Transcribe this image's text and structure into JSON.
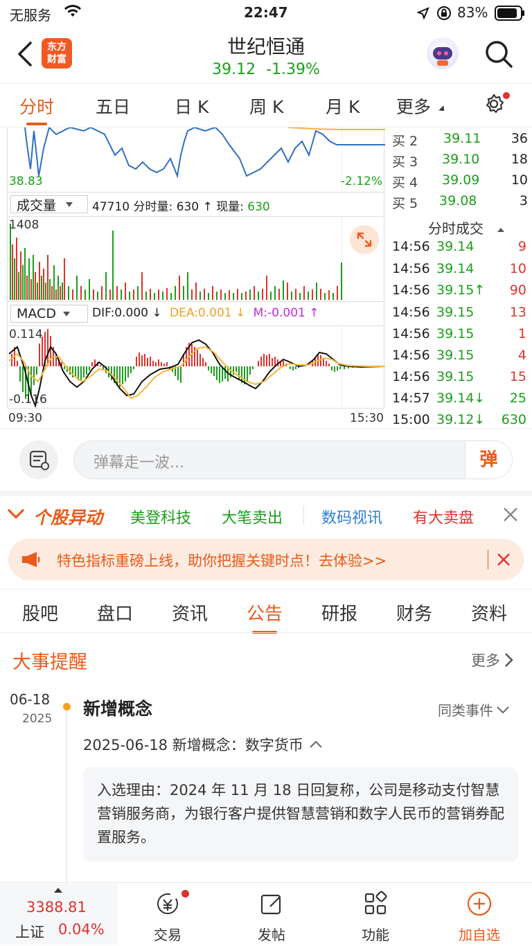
{
  "status_bar": {
    "carrier": "无服务",
    "time": "22:47",
    "battery": "83%"
  },
  "header": {
    "app_logo_text": "东方\n财富",
    "stock_name": "世纪恒通",
    "price": "39.12",
    "change_pct": "-1.39%"
  },
  "tabs": [
    {
      "label": "分时",
      "active": true
    },
    {
      "label": "五日"
    },
    {
      "label": "日 K"
    },
    {
      "label": "周 K"
    },
    {
      "label": "月 K"
    },
    {
      "label": "更多"
    }
  ],
  "price_chart": {
    "low_label": "38.83",
    "low_pct": "-2.12%"
  },
  "volume": {
    "selector": "成交量",
    "info_total": "47710",
    "info_min_label": "分时量:",
    "info_min_value": "630",
    "info_now_label": "现量:",
    "info_now_value": "630",
    "max_label": "1408"
  },
  "macd": {
    "selector": "MACD",
    "dif": "DIF:0.000 ↓",
    "dea": "DEA:0.001 ↓",
    "m": "M:-0.001 ↑",
    "top_label": "0.114",
    "bottom_label": "-0.116",
    "start_time": "09:30",
    "end_time": "15:30"
  },
  "order_book": [
    {
      "label": "买 2",
      "price": "39.11",
      "vol": "36"
    },
    {
      "label": "买 3",
      "price": "39.10",
      "vol": "18"
    },
    {
      "label": "买 4",
      "price": "39.09",
      "vol": "10"
    },
    {
      "label": "买 5",
      "price": "39.08",
      "vol": "3"
    }
  ],
  "trades_header": "分时成交",
  "trades": [
    {
      "time": "14:56",
      "price": "39.14",
      "vol": "9",
      "arrow": ""
    },
    {
      "time": "14:56",
      "price": "39.14",
      "vol": "10",
      "arrow": ""
    },
    {
      "time": "14:56",
      "price": "39.15↑",
      "vol": "90",
      "arrow": "up"
    },
    {
      "time": "14:56",
      "price": "39.15",
      "vol": "13",
      "arrow": ""
    },
    {
      "time": "14:56",
      "price": "39.15",
      "vol": "1",
      "arrow": ""
    },
    {
      "time": "14:56",
      "price": "39.15",
      "vol": "4",
      "arrow": ""
    },
    {
      "time": "14:56",
      "price": "39.15",
      "vol": "15",
      "arrow": ""
    },
    {
      "time": "14:57",
      "price": "39.14↓",
      "vol": "25",
      "arrow": "down"
    },
    {
      "time": "15:00",
      "price": "39.12↓",
      "vol": "630",
      "arrow": "down"
    }
  ],
  "danmaku": {
    "placeholder": "弹幕走一波...",
    "button": "弹"
  },
  "movement_bar": {
    "title": "个股异动",
    "items": [
      "美登科技",
      "大笔卖出",
      "数码视讯",
      "有大卖盘"
    ]
  },
  "promo": {
    "text": "特色指标重磅上线，助你把握关键时点！去体验>>"
  },
  "subtabs": [
    "股吧",
    "盘口",
    "资讯",
    "公告",
    "研报",
    "财务",
    "资料"
  ],
  "events": {
    "title": "大事提醒",
    "more": "更多",
    "date": "06-18",
    "year": "2025",
    "event_title": "新增概念",
    "same_type": "同类事件",
    "detail_title": "2025-06-18 新增概念：数字货币",
    "reason": "入选理由：2024 年 11 月 18 日回复称，公司是移动支付智慧营销服务商，为银行客户提供智慧营销和数字人民币的营销券配置服务。"
  },
  "bottom_bar": {
    "index_value": "3388.81",
    "index_name": "上证",
    "index_change": "0.04%",
    "trade": "交易",
    "post": "发帖",
    "functions": "功能",
    "add_watch": "加自选"
  }
}
